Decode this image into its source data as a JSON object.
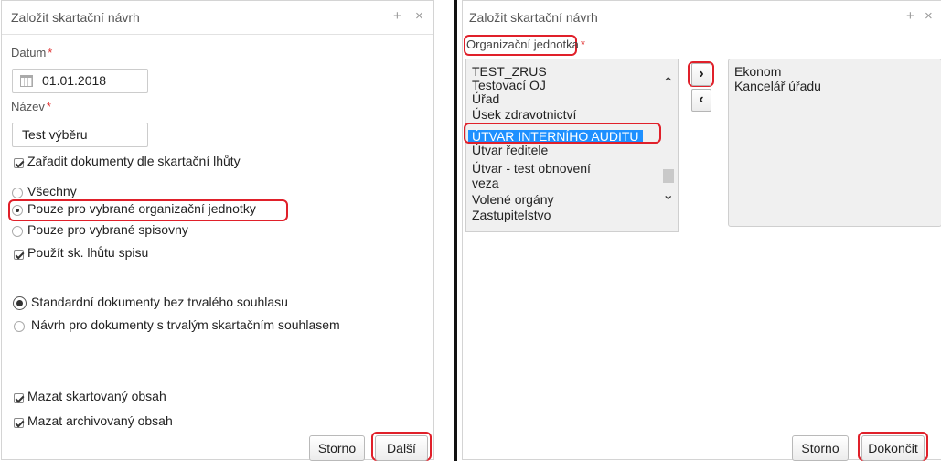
{
  "left_dialog": {
    "title": "Založit skartační návrh",
    "plus": "+",
    "close": "×",
    "datum_label": "Datum",
    "datum_value": "01.01.2018",
    "nazev_label": "Název",
    "nazev_value": "Test výběru",
    "required_mark": "*",
    "zaradit": "Zařadit dokumenty dle skartační lhůty",
    "radio_vsechny": "Všechny",
    "radio_org": "Pouze pro vybrané organizační jednotky",
    "radio_spisovny": "Pouze pro vybrané spisovny",
    "pouzit": "Použít sk. lhůtu spisu",
    "radio_standard": "Standardní dokumenty bez trvalého souhlasu",
    "radio_navrh": "Návrh pro dokumenty s trvalým skartačním souhlasem",
    "mazat_skart": "Mazat skartovaný obsah",
    "mazat_archiv": "Mazat archivovaný obsah",
    "storno": "Storno",
    "dalsi": "Další"
  },
  "right_dialog": {
    "title": "Založit skartační návrh",
    "plus": "+",
    "close": "×",
    "org_label": "Organizační jednotka",
    "required_mark": "*",
    "available": [
      "TEST_ZRUS",
      "Testovací OJ",
      "Úřad",
      "Úsek zdravotnictví",
      "ÚTVAR INTERNÍHO AUDITU",
      "Útvar ředitele",
      "Útvar - test obnovení",
      "veza",
      "Volené orgány",
      "Zastupitelstvo"
    ],
    "selected_index": 4,
    "chosen": [
      "Ekonom",
      "Kancelář úřadu"
    ],
    "move_right": "›",
    "move_left": "‹",
    "scroll_up": "⌃",
    "scroll_down": "⌄",
    "storno": "Storno",
    "dokoncit": "Dokončit"
  },
  "colors": {
    "highlight": "#e0202a",
    "selection": "#1e90ff"
  }
}
